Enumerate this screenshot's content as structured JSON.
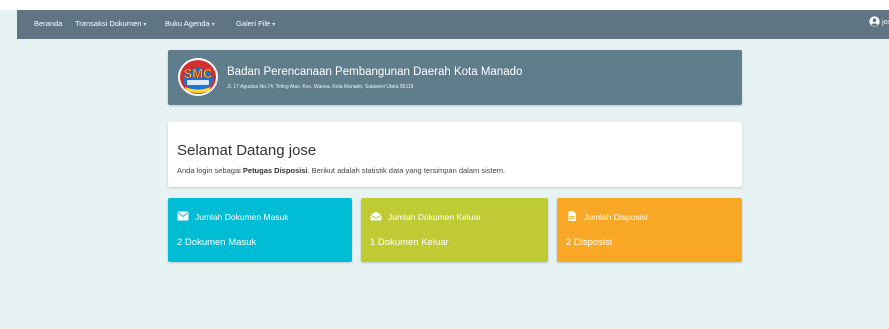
{
  "nav": {
    "items": [
      {
        "label": "Beranda"
      },
      {
        "label": "Transaksi Dokumen",
        "caret": "▾"
      },
      {
        "label": "Buku Agenda",
        "caret": "▾"
      },
      {
        "label": "Galeri File",
        "caret": "▾"
      }
    ],
    "user": {
      "name": "jose",
      "caret": "▾",
      "icon": "user-circle-icon"
    }
  },
  "header": {
    "org_name": "Badan Perencanaan Pembangunan Daerah Kota Manado",
    "address": "Jl. 17 Agustus No.74, Teling Atas, Kec. Wanea, Kota Manado, Sulawesi Utara 95119",
    "logo_letters": "SMC"
  },
  "welcome": {
    "title": "Selamat Datang jose",
    "text_before": "Anda login sebagai ",
    "role": "Petugas Disposisi",
    "text_after": ". Berikut adalah statistik data yang tersimpan dalam sistem."
  },
  "stats": [
    {
      "icon": "envelope-icon",
      "title": "Jumlah Dokumen Masuk",
      "value": "2 Dokumen Masuk",
      "color": "#00bcd4"
    },
    {
      "icon": "envelope-open-icon",
      "title": "Jumlah Dokumen Keluar",
      "value": "1 Dokumen Keluar",
      "color": "#c0ca33"
    },
    {
      "icon": "file-icon",
      "title": "Jumlah Disposisi",
      "value": "2 Disposisi",
      "color": "#f9a825"
    }
  ],
  "colors": {
    "navbar": "#5f7583",
    "header_panel": "#607d8b",
    "page_bg": "#e6f3f2"
  }
}
